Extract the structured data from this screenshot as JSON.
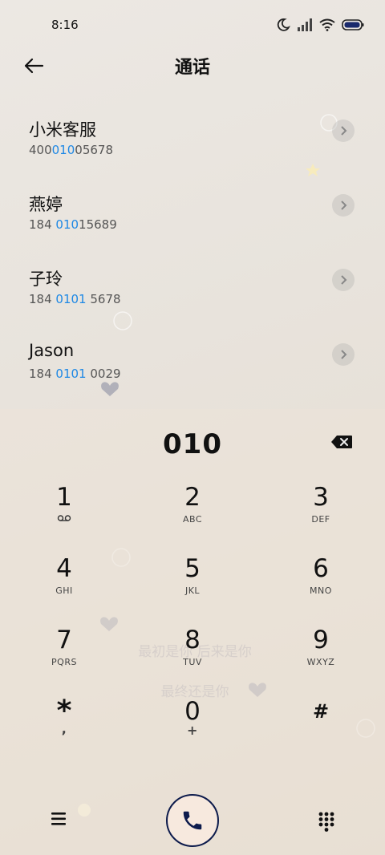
{
  "status_bar": {
    "time": "8:16"
  },
  "header": {
    "title": "通话"
  },
  "contacts": [
    {
      "name": "小米客服",
      "number_prefix": "400",
      "number_match": "010",
      "number_suffix": "05678"
    },
    {
      "name": "燕婷",
      "number_prefix": "184 ",
      "number_match": "010",
      "number_suffix": "15689"
    },
    {
      "name": "子玲",
      "number_prefix": "184 ",
      "number_match": "0101",
      "number_suffix": " 5678"
    },
    {
      "name": "Jason",
      "number_prefix": "184 ",
      "number_match": "0101",
      "number_suffix": " 0029"
    }
  ],
  "dialer": {
    "input": "010",
    "keys": [
      {
        "digit": "1",
        "sub": ""
      },
      {
        "digit": "2",
        "sub": "ABC"
      },
      {
        "digit": "3",
        "sub": "DEF"
      },
      {
        "digit": "4",
        "sub": "GHI"
      },
      {
        "digit": "5",
        "sub": "JKL"
      },
      {
        "digit": "6",
        "sub": "MNO"
      },
      {
        "digit": "7",
        "sub": "PQRS"
      },
      {
        "digit": "8",
        "sub": "TUV"
      },
      {
        "digit": "9",
        "sub": "WXYZ"
      },
      {
        "digit": "*",
        "sub": ","
      },
      {
        "digit": "0",
        "sub": "+"
      },
      {
        "digit": "#",
        "sub": ""
      }
    ]
  },
  "accent_color": "#1e88e5",
  "call_button_border_color": "#0d1b4c",
  "icons": {
    "back": "arrow-left-icon",
    "backspace": "backspace-icon",
    "voicemail": "voicemail-icon",
    "menu": "menu-icon",
    "call": "phone-icon",
    "keypad": "dialpad-icon",
    "contact_arrow": "chevron-right-icon"
  }
}
